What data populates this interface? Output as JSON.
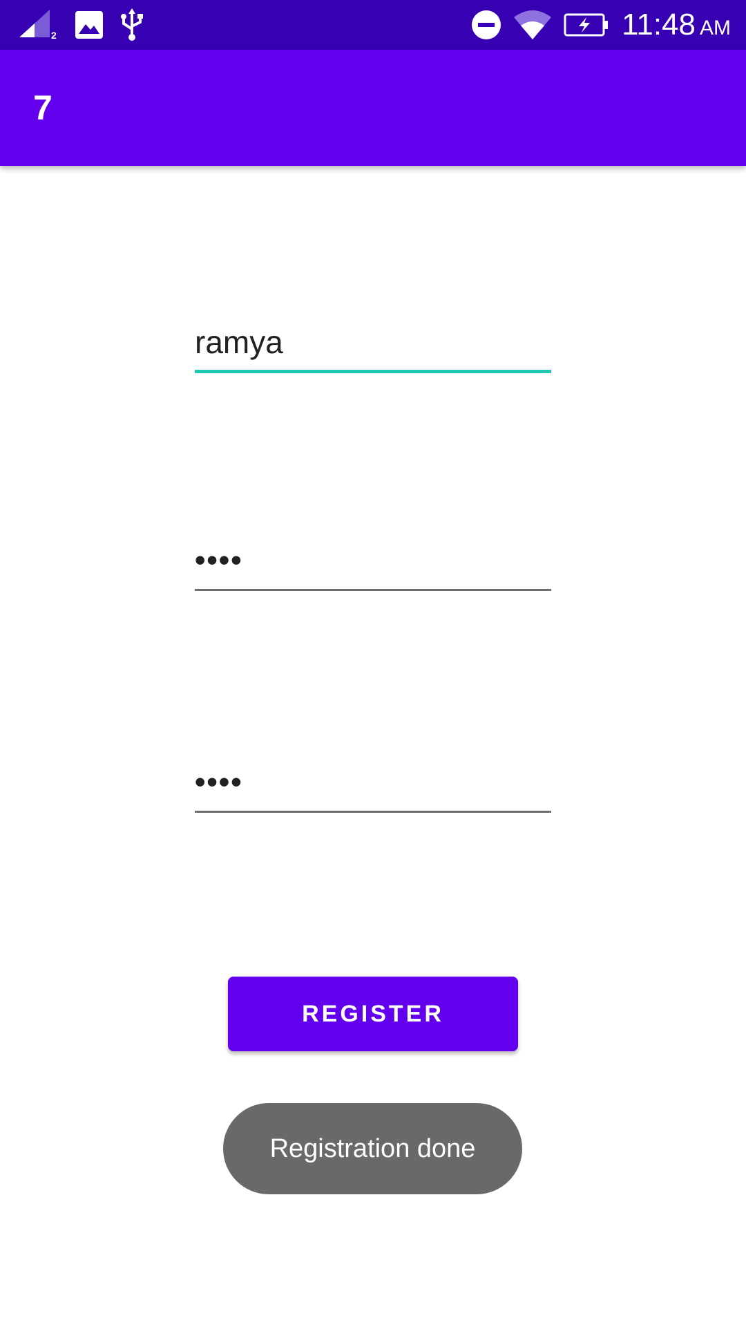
{
  "status_bar": {
    "signal_badge": "2",
    "time": "11:48",
    "ampm": "AM",
    "icons": [
      "cell-signal-icon",
      "image-icon",
      "usb-icon",
      "do-not-disturb-icon",
      "wifi-icon",
      "battery-charging-icon"
    ],
    "background_color": "#3700b3"
  },
  "app_bar": {
    "title": "7",
    "background_color": "#6200ee"
  },
  "form": {
    "username_value": "ramya",
    "password_value": "••••",
    "confirm_password_value": "••••",
    "focus_color": "#1fc9b5"
  },
  "register_button": {
    "label": "REGISTER",
    "color": "#6200ee"
  },
  "toast": {
    "message": "Registration done"
  }
}
